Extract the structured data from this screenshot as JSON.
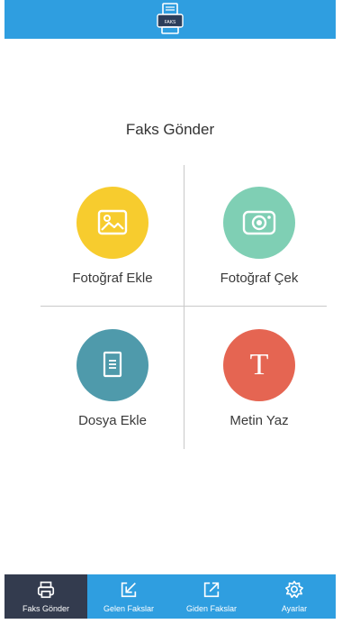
{
  "header": {
    "logo_icon": "fax-machine-icon",
    "logo_text": "FAKS",
    "background": "#2f9ee0"
  },
  "main": {
    "title": "Faks Gönder",
    "actions": [
      {
        "label": "Fotoğraf Ekle",
        "icon": "image-icon",
        "color": "#f7cc2e"
      },
      {
        "label": "Fotoğraf Çek",
        "icon": "camera-icon",
        "color": "#7fcfb4"
      },
      {
        "label": "Dosya Ekle",
        "icon": "document-icon",
        "color": "#4f9aab"
      },
      {
        "label": "Metin Yaz",
        "icon": "text-icon",
        "glyph": "T",
        "color": "#e56552"
      }
    ]
  },
  "tabbar": {
    "tabs": [
      {
        "label": "Faks Gönder",
        "icon": "printer-icon",
        "active": true
      },
      {
        "label": "Gelen Fakslar",
        "icon": "inbox-arrow-icon",
        "active": false
      },
      {
        "label": "Giden Fakslar",
        "icon": "outbox-arrow-icon",
        "active": false
      },
      {
        "label": "Ayarlar",
        "icon": "gear-icon",
        "active": false
      }
    ],
    "active_color": "#333b4e"
  }
}
